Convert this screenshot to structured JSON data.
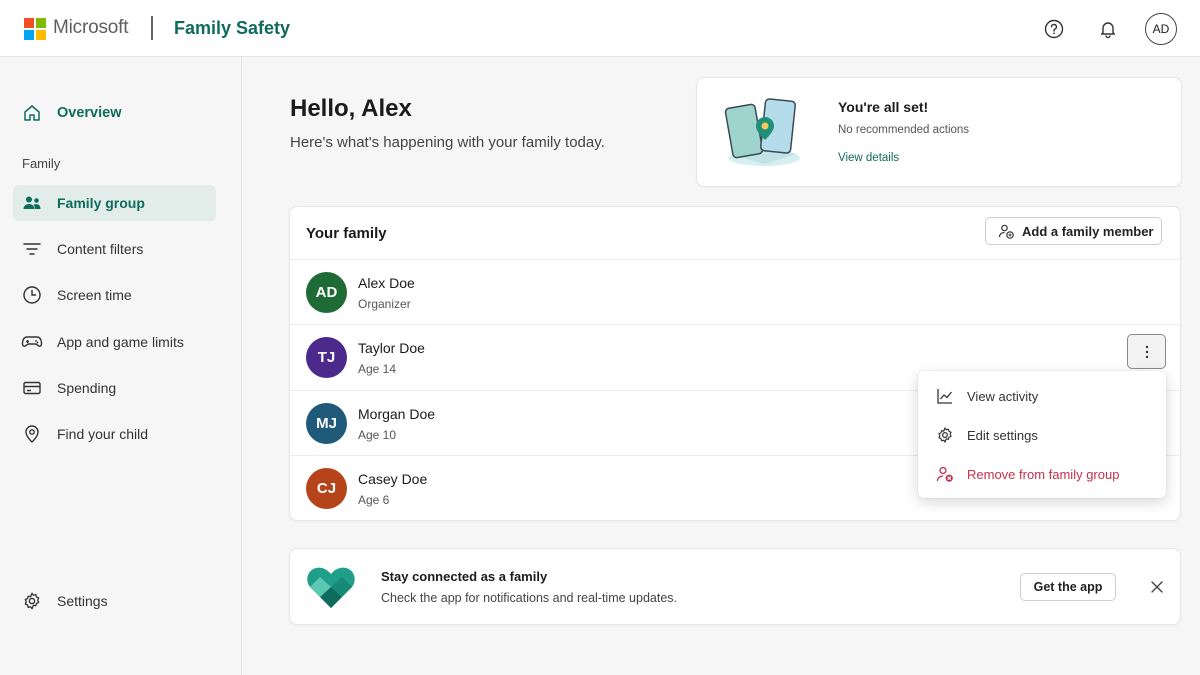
{
  "header": {
    "brand": "Microsoft",
    "app_name": "Family Safety",
    "avatar_initials": "AD",
    "icons": [
      "help-icon",
      "bell-icon"
    ]
  },
  "sidebar": {
    "overview_label": "Overview",
    "section_label": "Family",
    "items": [
      {
        "label": "Family group",
        "icon": "people-icon"
      },
      {
        "label": "Content filters",
        "icon": "filter-icon"
      },
      {
        "label": "Screen time",
        "icon": "clock-icon"
      },
      {
        "label": "App and game limits",
        "icon": "gamepad-icon"
      },
      {
        "label": "Spending",
        "icon": "card-icon"
      },
      {
        "label": "Find your child",
        "icon": "location-pin-icon"
      }
    ],
    "settings_label": "Settings"
  },
  "main": {
    "greeting": "Hello, Alex",
    "subtitle": "Here's what's happening with your family today."
  },
  "status_card": {
    "title": "You're all set!",
    "subtitle": "No recommended actions",
    "link": "View details"
  },
  "family": {
    "title": "Your family",
    "add_button": "Add a family member",
    "members": [
      {
        "initials": "AD",
        "name": "Alex Doe",
        "detail": "Organizer",
        "color": "#1e6b35"
      },
      {
        "initials": "TJ",
        "name": "Taylor Doe",
        "detail": "Age 14",
        "color": "#4b2a8c"
      },
      {
        "initials": "MJ",
        "name": "Morgan Doe",
        "detail": "Age 10",
        "color": "#1f5a7a"
      },
      {
        "initials": "CJ",
        "name": "Casey Doe",
        "detail": "Age 6",
        "color": "#b5441a"
      }
    ]
  },
  "context_menu": {
    "items": [
      {
        "label": "View activity",
        "icon": "chart-line-icon"
      },
      {
        "label": "Edit settings",
        "icon": "gear-icon"
      },
      {
        "label": "Remove from family group",
        "icon": "remove-person-icon"
      }
    ]
  },
  "promo": {
    "title": "Stay connected as a family",
    "subtitle": "Check the app for notifications and real-time updates.",
    "button": "Get the app"
  },
  "colors": {
    "accent": "#0f6b5c",
    "danger": "#c4314b",
    "active_nav_bg": "#e2ece9"
  }
}
